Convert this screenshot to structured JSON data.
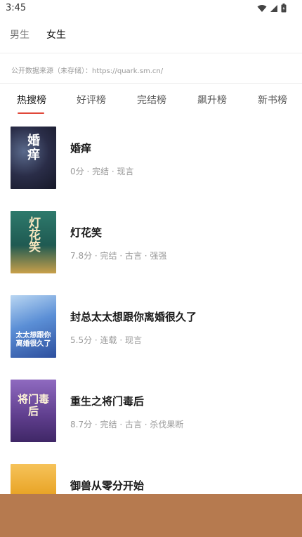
{
  "status": {
    "time": "3:45"
  },
  "gender_tabs": [
    {
      "label": "男生",
      "active": false
    },
    {
      "label": "女生",
      "active": true
    }
  ],
  "source_note": "公开数据来源（未存储）：https://quark.sm.cn/",
  "rank_tabs": [
    {
      "label": "热搜榜",
      "active": true
    },
    {
      "label": "好评榜",
      "active": false
    },
    {
      "label": "完结榜",
      "active": false
    },
    {
      "label": "飙升榜",
      "active": false
    },
    {
      "label": "新书榜",
      "active": false
    }
  ],
  "books": [
    {
      "title": "婚痒",
      "meta": "0分 · 完结 · 现言",
      "cover_text": "婚痒",
      "cover_color": "#1f2236"
    },
    {
      "title": "灯花笑",
      "meta": "7.8分 · 完结 · 古言 · 强强",
      "cover_text": "灯花笑",
      "cover_color": "#1f5a52"
    },
    {
      "title": "封总太太想跟你离婚很久了",
      "meta": "5.5分 · 连载 · 现言",
      "cover_text": "太太想跟你离婚很久了",
      "cover_color": "#3a6fc0"
    },
    {
      "title": "重生之将门毒后",
      "meta": "8.7分 · 完结 · 古言 · 杀伐果断",
      "cover_text": "将门毒后",
      "cover_color": "#5e3d8c"
    },
    {
      "title": "御兽从零分开始",
      "meta": "",
      "cover_text": "",
      "cover_color": "#e8a325"
    }
  ],
  "colors": {
    "accent": "#e0483a",
    "overlay": "#b67a4f"
  }
}
